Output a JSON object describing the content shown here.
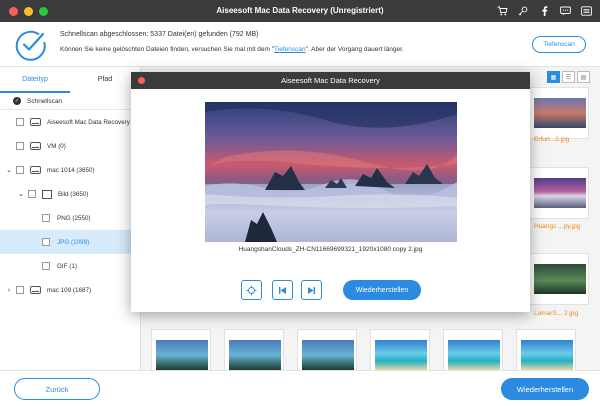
{
  "app": {
    "title": "Aiseesoft Mac Data Recovery (Unregistriert)",
    "colors": {
      "accent": "#2c8be0",
      "titlebar": "#3b3b3d",
      "warning": "#f28a1a"
    }
  },
  "title_icons": [
    "cart-icon",
    "key-icon",
    "facebook-icon",
    "chat-icon",
    "menu-icon"
  ],
  "status": {
    "line1": "Schnellscan abgeschlossen: 5337 Datei(en) gefunden (792 MB)",
    "line2_before": "Können Sie keine gelöschten Dateien finden, versuchen Sie mal mit dem \"",
    "line2_link": "Tiefenscan",
    "line2_after": "\". Aber der Vorgang dauert länger.",
    "deep_scan_button": "Tiefenscan"
  },
  "sidebar": {
    "tabs": [
      "Dateityp",
      "Pfad"
    ],
    "scan_mode": "Schnellscan",
    "tree": [
      {
        "label": "Aiseesoft Mac Data Recovery"
      },
      {
        "label": "VM (0)"
      },
      {
        "label": "mac 1014 (3650)"
      },
      {
        "label": "Bild (3650)"
      },
      {
        "label": "PNG (2550)"
      },
      {
        "label": "JPG (1099)"
      },
      {
        "label": "GIF (1)"
      },
      {
        "label": "mac 109 (1687)"
      }
    ]
  },
  "thumb_labels": [
    "Erfurt...2.jpg",
    "Huangs....py.jpg",
    "LamarS... 2.jpg"
  ],
  "modal": {
    "title": "Aiseesoft Mac Data Recovery",
    "filename": "HuangshanClouds_ZH-CN11669699321_1920x1080 copy 2.jpg",
    "restore_button": "Wiederherstellen"
  },
  "bottom": {
    "back_button": "Zurück",
    "restore_button": "Wiederherstellen"
  }
}
